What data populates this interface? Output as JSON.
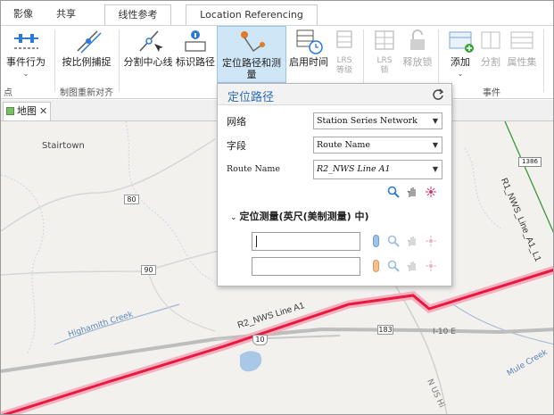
{
  "tabs": [
    {
      "label": "影像"
    },
    {
      "label": "共享"
    },
    {
      "label": "线性参考"
    },
    {
      "label": "Location Referencing"
    }
  ],
  "ribbon": {
    "buttons": [
      {
        "label": "事件行为"
      },
      {
        "label": "按比例捕捉"
      },
      {
        "label": "分割中心线"
      },
      {
        "label": "标识路径"
      },
      {
        "label": "定位路径和测量"
      },
      {
        "label": "启用时间"
      },
      {
        "label": "LRS\n等级"
      },
      {
        "label": "LRS\n锁"
      },
      {
        "label": "释放锁"
      },
      {
        "label": "添加"
      },
      {
        "label": "分割"
      },
      {
        "label": "属性集"
      }
    ],
    "group_labels": {
      "left": "点",
      "mid": "制图重新对齐",
      "right": "事件"
    }
  },
  "map_tab": {
    "label": "地图"
  },
  "map": {
    "places": [
      "Stairtown",
      "Highamith Creek",
      "Mule Creek"
    ],
    "roads": [
      "80",
      "90",
      "10",
      "183",
      "I-10 E",
      "N US Hi"
    ],
    "route_labels": [
      "R2_NWS Line A1",
      "R1_NWS_Line_A1_L1"
    ],
    "mile_marker": "1386"
  },
  "panel": {
    "title": "定位路径",
    "network_label": "网络",
    "network_value": "Station Series Network",
    "field_label": "字段",
    "field_value": "Route Name",
    "route_label": "Route Name",
    "route_value": "R2_NWS Line A1",
    "measure_section": "定位测量(英尺(美制测量) 中)"
  },
  "colors": {
    "accent": "#2b7bd6",
    "route_red": "#e8193f",
    "active_button": "#cfe6f7"
  }
}
